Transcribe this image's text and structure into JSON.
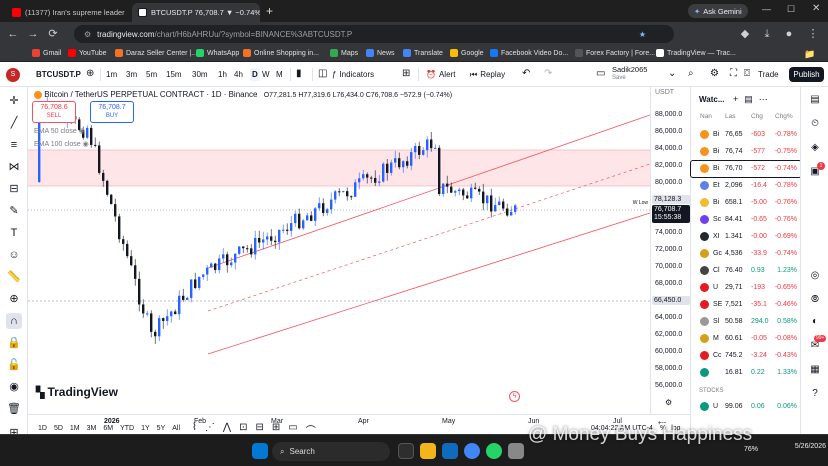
{
  "browser": {
    "tabs": [
      {
        "title": "(11377) Iran's supreme leader",
        "active": false
      },
      {
        "title": "BTCUSDT.P 76,708.7 ▼ −0.74%",
        "active": true
      }
    ],
    "new_tab": "+",
    "gemini": "Ask Gemini",
    "url_domain": "tradingview.com",
    "url_rest": "/chart/H6bAHRUu/?symbol=BINANCE%3ABTCUSDT.P",
    "bookmarks": [
      "Gmail",
      "YouTube",
      "Daraz Seller Center |...",
      "WhatsApp",
      "Online Shopping in...",
      "Maps",
      "News",
      "Translate",
      "Google",
      "Facebook Video Do...",
      "Forex Factory | Fore...",
      "TradingView — Trac..."
    ]
  },
  "toolbar": {
    "symbol": "BTCUSDT.P",
    "intervals": [
      "1m",
      "3m",
      "5m",
      "15m",
      "30m",
      "1h",
      "4h",
      "D",
      "W",
      "M"
    ],
    "selected_interval": "D",
    "indicators": "Indicators",
    "alert": "Alert",
    "replay": "Replay",
    "user": "Sadik2065",
    "save": "Save",
    "trade": "Trade",
    "publish": "Publish"
  },
  "legend": {
    "title": "Bitcoin / TetherUS PERPETUAL CONTRACT · 1D · Binance",
    "ohlc": "O77,281.5 H77,319.6 L76,434.0 C76,708.6 −572.9 (−0.74%)",
    "sell_price": "76,708.6",
    "sell_label": "SELL",
    "buy_price": "76,708.7",
    "buy_label": "BUY",
    "ema50": "EMA 50 close",
    "ema100": "EMA 100 close"
  },
  "price_axis": {
    "currency": "USDT",
    "labels": [
      "88,000.0",
      "86,000.0",
      "84,000.0",
      "82,000.0",
      "80,000.0",
      "78,000.0",
      "74,000.0",
      "72,000.0",
      "70,000.0",
      "68,000.0",
      "64,000.0",
      "62,000.0",
      "60,000.0",
      "58,000.0",
      "56,000.0"
    ],
    "tag_upper": "78,128.3",
    "tag_current": "76,708.7",
    "tag_timer": "15:55:38",
    "tag_lower": "66,450.0",
    "wlow": "W Low"
  },
  "time_axis": {
    "labels": [
      "2026",
      "Feb",
      "Mar",
      "Apr",
      "May",
      "Jun",
      "Jul"
    ],
    "ranges": [
      "1D",
      "5D",
      "1M",
      "3M",
      "6M",
      "YTD",
      "1Y",
      "5Y",
      "All"
    ],
    "clock": "04:04:22 AM UTC-4",
    "mode_pct": "%",
    "mode_log": "log",
    "mode_auto": "auto"
  },
  "logo": "TradingView",
  "watchlist": {
    "title": "Watc...",
    "headers": [
      "Nan",
      "Las",
      "Chg",
      "Chg%"
    ],
    "rows": [
      {
        "sym": "Bi",
        "last": "76,65",
        "chg": "-603",
        "pct": "-0.78%",
        "color": "#f7931a",
        "dir": "neg"
      },
      {
        "sym": "Bi",
        "last": "76,74",
        "chg": "-577",
        "pct": "-0.75%",
        "color": "#f7931a",
        "dir": "neg"
      },
      {
        "sym": "Bi",
        "last": "76,70",
        "chg": "-572",
        "pct": "-0.74%",
        "color": "#f7931a",
        "dir": "neg"
      },
      {
        "sym": "Et",
        "last": "2,096",
        "chg": "-16.4",
        "pct": "-0.78%",
        "color": "#627eea",
        "dir": "neg"
      },
      {
        "sym": "Bi",
        "last": "658.1",
        "chg": "-5.00",
        "pct": "-0.76%",
        "color": "#f3ba2f",
        "dir": "neg"
      },
      {
        "sym": "Sc",
        "last": "84.41",
        "chg": "-0.65",
        "pct": "-0.76%",
        "color": "#6e3ff3",
        "dir": "neg"
      },
      {
        "sym": "XI",
        "last": "1.341",
        "chg": "-0.00",
        "pct": "-0.69%",
        "color": "#23292f",
        "dir": "neg"
      },
      {
        "sym": "Gc",
        "last": "4,536",
        "chg": "-33.9",
        "pct": "-0.74%",
        "color": "#d4a017",
        "dir": "neg"
      },
      {
        "sym": "Cl",
        "last": "76.40",
        "chg": "0.93",
        "pct": "1.23%",
        "color": "#444444",
        "dir": "pos"
      },
      {
        "sym": "U",
        "last": "29,71",
        "chg": "-193",
        "pct": "-0.65%",
        "color": "#e31b23",
        "dir": "neg"
      },
      {
        "sym": "SE",
        "last": "7,521",
        "chg": "-35.1",
        "pct": "-0.46%",
        "color": "#e31b23",
        "dir": "neg"
      },
      {
        "sym": "Sl",
        "last": "50.58",
        "chg": "294.0",
        "pct": "0.58%",
        "color": "#999999",
        "dir": "pos"
      },
      {
        "sym": "M",
        "last": "60.61",
        "chg": "-0.05",
        "pct": "-0.08%",
        "color": "#d4a017",
        "dir": "neg"
      },
      {
        "sym": "Cc",
        "last": "745.2",
        "chg": "-3.24",
        "pct": "-0.43%",
        "color": "#e31b23",
        "dir": "neg"
      },
      {
        "sym": "",
        "last": "16.81",
        "chg": "0.22",
        "pct": "1.33%",
        "color": "#089981",
        "dir": "pos"
      }
    ],
    "section": "STOCKS",
    "stock_row": {
      "sym": "U",
      "last": "99.06",
      "chg": "0.06",
      "pct": "0.06%",
      "color": "#089981",
      "dir": "pos"
    }
  },
  "taskbar": {
    "search": "Search",
    "time": "5/26/2026",
    "battery": "76%"
  },
  "watermark": "@ Money Buys Happiness",
  "colors": {
    "up": "#2962ff",
    "down": "#131722",
    "channel": "#f7525f",
    "zone": "#fce4e6"
  }
}
